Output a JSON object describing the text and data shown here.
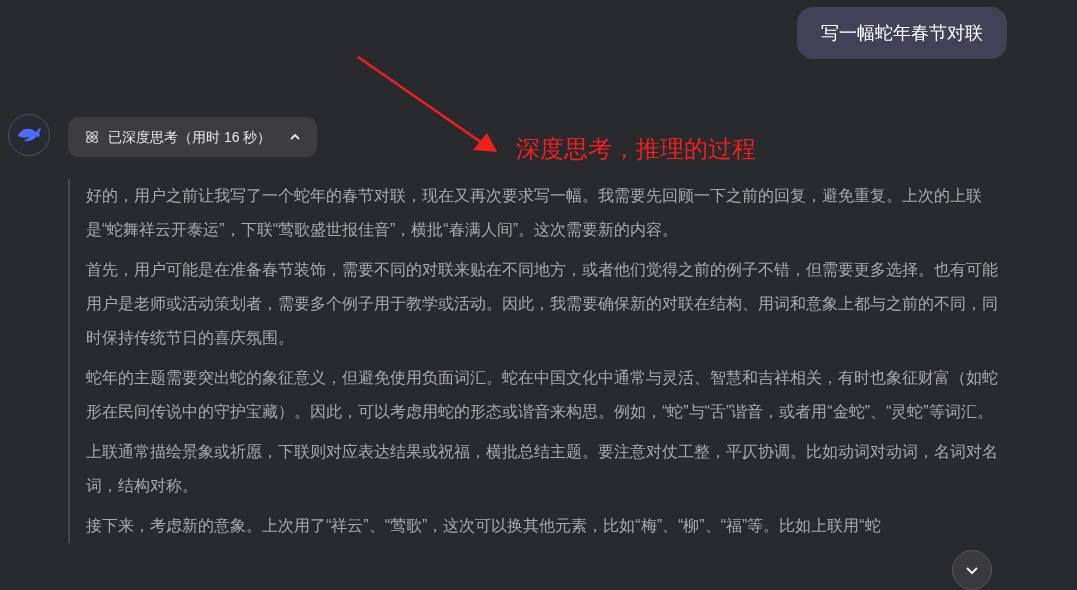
{
  "user_message": {
    "text": "写一幅蛇年春节对联"
  },
  "annotation": {
    "text": "深度思考，推理的过程"
  },
  "thinking": {
    "label": "已深度思考（用时 16 秒）",
    "expanded": true,
    "paragraphs": [
      "好的，用户之前让我写了一个蛇年的春节对联，现在又再次要求写一幅。我需要先回顾一下之前的回复，避免重复。上次的上联是“蛇舞祥云开泰运”，下联“莺歌盛世报佳音”，横批“春满人间”。这次需要新的内容。",
      "首先，用户可能是在准备春节装饰，需要不同的对联来贴在不同地方，或者他们觉得之前的例子不错，但需要更多选择。也有可能用户是老师或活动策划者，需要多个例子用于教学或活动。因此，我需要确保新的对联在结构、用词和意象上都与之前的不同，同时保持传统节日的喜庆氛围。",
      "蛇年的主题需要突出蛇的象征意义，但避免使用负面词汇。蛇在中国文化中通常与灵活、智慧和吉祥相关，有时也象征财富（如蛇形在民间传说中的守护宝藏）。因此，可以考虑用蛇的形态或谐音来构思。例如，“蛇”与“舌”谐音，或者用“金蛇”、“灵蛇”等词汇。",
      "上联通常描绘景象或祈愿，下联则对应表达结果或祝福，横批总结主题。要注意对仗工整，平仄协调。比如动词对动词，名词对名词，结构对称。",
      "接下来，考虑新的意象。上次用了“祥云”、“莺歌”，这次可以换其他元素，比如“梅”、“柳”、“福”等。比如上联用“蛇"
    ]
  }
}
